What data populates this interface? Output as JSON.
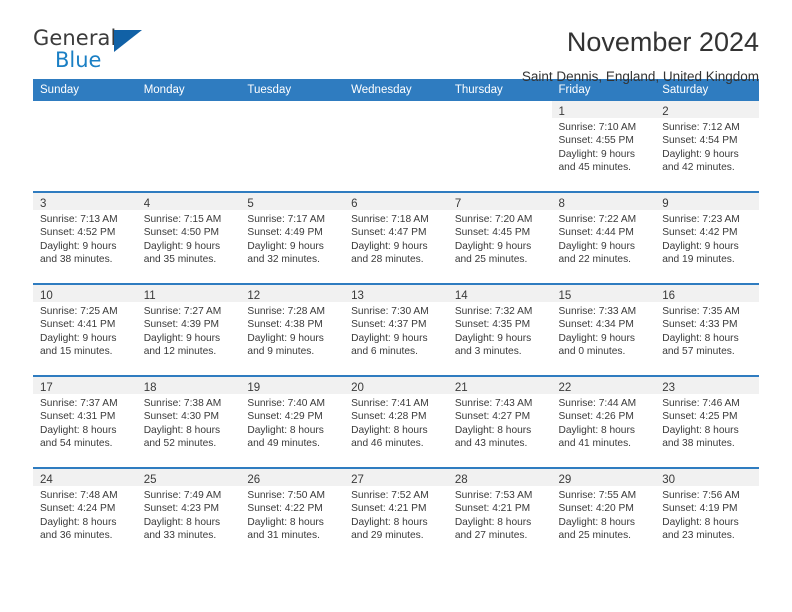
{
  "brand": {
    "name_part1": "General",
    "name_part2": "Blue",
    "triangle_color": "#1161a6",
    "blue_color": "#1a7fc4"
  },
  "header": {
    "title": "November 2024",
    "subtitle": "Saint Dennis, England, United Kingdom"
  },
  "theme": {
    "header_bg": "#2f7cc0",
    "header_text": "#ffffff",
    "daynum_strip_bg": "#f1f1f1",
    "row_divider": "#2f7cc0",
    "body_text": "#3a3a3a"
  },
  "weekday_headers": [
    "Sunday",
    "Monday",
    "Tuesday",
    "Wednesday",
    "Thursday",
    "Friday",
    "Saturday"
  ],
  "weeks": [
    [
      {
        "day": "",
        "lines": []
      },
      {
        "day": "",
        "lines": []
      },
      {
        "day": "",
        "lines": []
      },
      {
        "day": "",
        "lines": []
      },
      {
        "day": "",
        "lines": []
      },
      {
        "day": "1",
        "lines": [
          "Sunrise: 7:10 AM",
          "Sunset: 4:55 PM",
          "Daylight: 9 hours",
          "and 45 minutes."
        ]
      },
      {
        "day": "2",
        "lines": [
          "Sunrise: 7:12 AM",
          "Sunset: 4:54 PM",
          "Daylight: 9 hours",
          "and 42 minutes."
        ]
      }
    ],
    [
      {
        "day": "3",
        "lines": [
          "Sunrise: 7:13 AM",
          "Sunset: 4:52 PM",
          "Daylight: 9 hours",
          "and 38 minutes."
        ]
      },
      {
        "day": "4",
        "lines": [
          "Sunrise: 7:15 AM",
          "Sunset: 4:50 PM",
          "Daylight: 9 hours",
          "and 35 minutes."
        ]
      },
      {
        "day": "5",
        "lines": [
          "Sunrise: 7:17 AM",
          "Sunset: 4:49 PM",
          "Daylight: 9 hours",
          "and 32 minutes."
        ]
      },
      {
        "day": "6",
        "lines": [
          "Sunrise: 7:18 AM",
          "Sunset: 4:47 PM",
          "Daylight: 9 hours",
          "and 28 minutes."
        ]
      },
      {
        "day": "7",
        "lines": [
          "Sunrise: 7:20 AM",
          "Sunset: 4:45 PM",
          "Daylight: 9 hours",
          "and 25 minutes."
        ]
      },
      {
        "day": "8",
        "lines": [
          "Sunrise: 7:22 AM",
          "Sunset: 4:44 PM",
          "Daylight: 9 hours",
          "and 22 minutes."
        ]
      },
      {
        "day": "9",
        "lines": [
          "Sunrise: 7:23 AM",
          "Sunset: 4:42 PM",
          "Daylight: 9 hours",
          "and 19 minutes."
        ]
      }
    ],
    [
      {
        "day": "10",
        "lines": [
          "Sunrise: 7:25 AM",
          "Sunset: 4:41 PM",
          "Daylight: 9 hours",
          "and 15 minutes."
        ]
      },
      {
        "day": "11",
        "lines": [
          "Sunrise: 7:27 AM",
          "Sunset: 4:39 PM",
          "Daylight: 9 hours",
          "and 12 minutes."
        ]
      },
      {
        "day": "12",
        "lines": [
          "Sunrise: 7:28 AM",
          "Sunset: 4:38 PM",
          "Daylight: 9 hours",
          "and 9 minutes."
        ]
      },
      {
        "day": "13",
        "lines": [
          "Sunrise: 7:30 AM",
          "Sunset: 4:37 PM",
          "Daylight: 9 hours",
          "and 6 minutes."
        ]
      },
      {
        "day": "14",
        "lines": [
          "Sunrise: 7:32 AM",
          "Sunset: 4:35 PM",
          "Daylight: 9 hours",
          "and 3 minutes."
        ]
      },
      {
        "day": "15",
        "lines": [
          "Sunrise: 7:33 AM",
          "Sunset: 4:34 PM",
          "Daylight: 9 hours",
          "and 0 minutes."
        ]
      },
      {
        "day": "16",
        "lines": [
          "Sunrise: 7:35 AM",
          "Sunset: 4:33 PM",
          "Daylight: 8 hours",
          "and 57 minutes."
        ]
      }
    ],
    [
      {
        "day": "17",
        "lines": [
          "Sunrise: 7:37 AM",
          "Sunset: 4:31 PM",
          "Daylight: 8 hours",
          "and 54 minutes."
        ]
      },
      {
        "day": "18",
        "lines": [
          "Sunrise: 7:38 AM",
          "Sunset: 4:30 PM",
          "Daylight: 8 hours",
          "and 52 minutes."
        ]
      },
      {
        "day": "19",
        "lines": [
          "Sunrise: 7:40 AM",
          "Sunset: 4:29 PM",
          "Daylight: 8 hours",
          "and 49 minutes."
        ]
      },
      {
        "day": "20",
        "lines": [
          "Sunrise: 7:41 AM",
          "Sunset: 4:28 PM",
          "Daylight: 8 hours",
          "and 46 minutes."
        ]
      },
      {
        "day": "21",
        "lines": [
          "Sunrise: 7:43 AM",
          "Sunset: 4:27 PM",
          "Daylight: 8 hours",
          "and 43 minutes."
        ]
      },
      {
        "day": "22",
        "lines": [
          "Sunrise: 7:44 AM",
          "Sunset: 4:26 PM",
          "Daylight: 8 hours",
          "and 41 minutes."
        ]
      },
      {
        "day": "23",
        "lines": [
          "Sunrise: 7:46 AM",
          "Sunset: 4:25 PM",
          "Daylight: 8 hours",
          "and 38 minutes."
        ]
      }
    ],
    [
      {
        "day": "24",
        "lines": [
          "Sunrise: 7:48 AM",
          "Sunset: 4:24 PM",
          "Daylight: 8 hours",
          "and 36 minutes."
        ]
      },
      {
        "day": "25",
        "lines": [
          "Sunrise: 7:49 AM",
          "Sunset: 4:23 PM",
          "Daylight: 8 hours",
          "and 33 minutes."
        ]
      },
      {
        "day": "26",
        "lines": [
          "Sunrise: 7:50 AM",
          "Sunset: 4:22 PM",
          "Daylight: 8 hours",
          "and 31 minutes."
        ]
      },
      {
        "day": "27",
        "lines": [
          "Sunrise: 7:52 AM",
          "Sunset: 4:21 PM",
          "Daylight: 8 hours",
          "and 29 minutes."
        ]
      },
      {
        "day": "28",
        "lines": [
          "Sunrise: 7:53 AM",
          "Sunset: 4:21 PM",
          "Daylight: 8 hours",
          "and 27 minutes."
        ]
      },
      {
        "day": "29",
        "lines": [
          "Sunrise: 7:55 AM",
          "Sunset: 4:20 PM",
          "Daylight: 8 hours",
          "and 25 minutes."
        ]
      },
      {
        "day": "30",
        "lines": [
          "Sunrise: 7:56 AM",
          "Sunset: 4:19 PM",
          "Daylight: 8 hours",
          "and 23 minutes."
        ]
      }
    ]
  ]
}
